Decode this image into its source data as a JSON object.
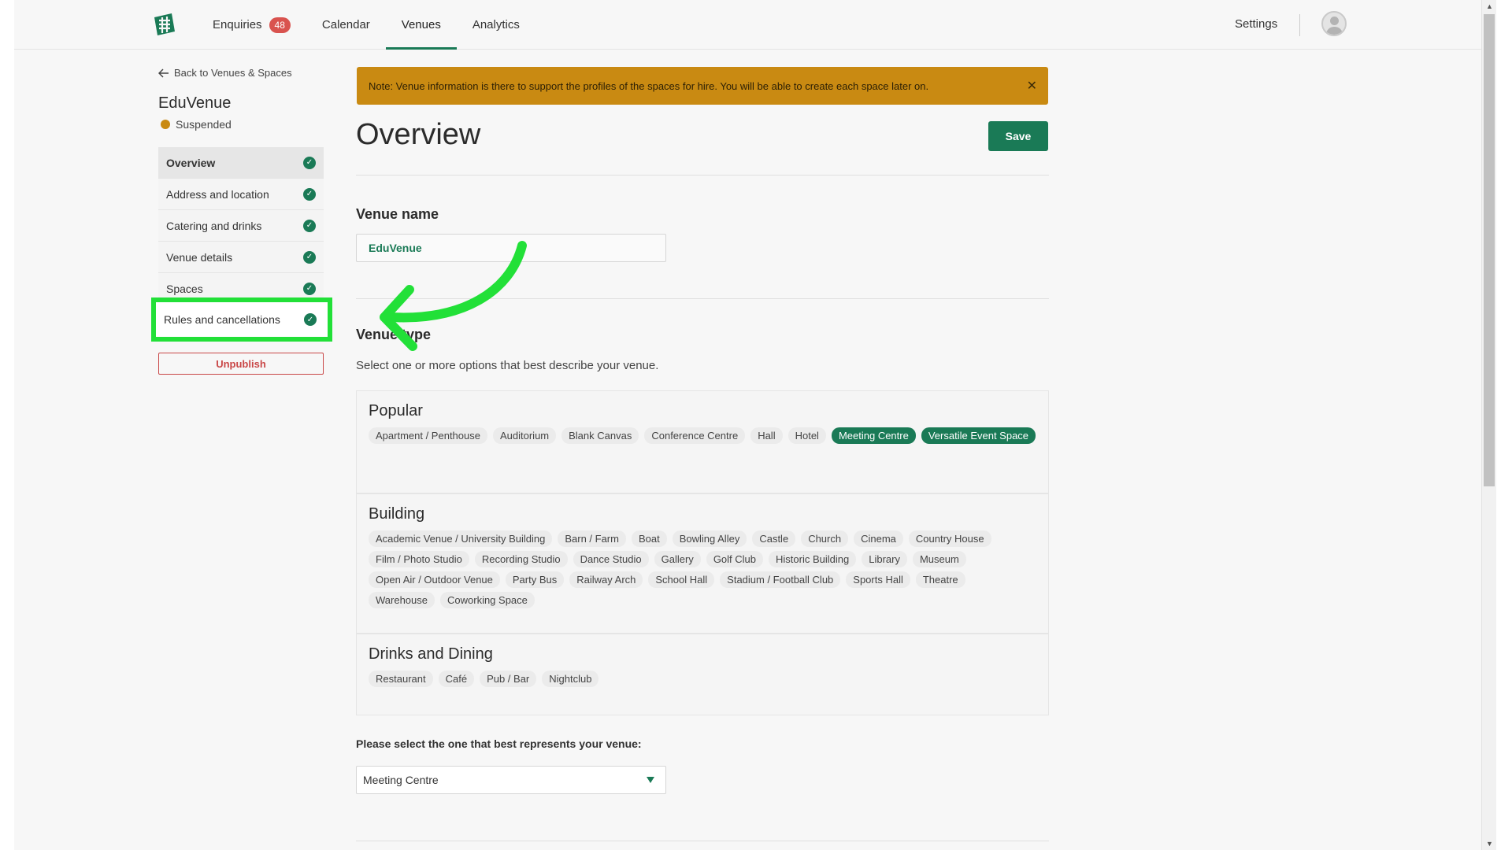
{
  "nav": {
    "items": [
      {
        "label": "Enquiries",
        "badge": "48"
      },
      {
        "label": "Calendar"
      },
      {
        "label": "Venues"
      },
      {
        "label": "Analytics"
      }
    ],
    "settings_label": "Settings"
  },
  "sidebar": {
    "back_label": "Back to Venues & Spaces",
    "venue_title": "EduVenue",
    "status": "Suspended",
    "items": [
      {
        "label": "Overview"
      },
      {
        "label": "Address and location"
      },
      {
        "label": "Catering and drinks"
      },
      {
        "label": "Venue details"
      },
      {
        "label": "Spaces"
      },
      {
        "label": "Rules and cancellations"
      }
    ],
    "unpublish_label": "Unpublish"
  },
  "main": {
    "note": "Note: Venue information is there to support the profiles of the spaces for hire. You will be able to create each space later on.",
    "title": "Overview",
    "save_label": "Save",
    "venue_name_label": "Venue name",
    "venue_name_value": "EduVenue",
    "venue_type_label": "Venue type",
    "venue_type_helper": "Select one or more options that best describe your venue.",
    "categories": [
      {
        "title": "Popular",
        "tags": [
          {
            "label": "Apartment / Penthouse"
          },
          {
            "label": "Auditorium"
          },
          {
            "label": "Blank Canvas"
          },
          {
            "label": "Conference Centre"
          },
          {
            "label": "Hall"
          },
          {
            "label": "Hotel"
          },
          {
            "label": "Meeting Centre",
            "selected": true
          },
          {
            "label": "Versatile Event Space",
            "selected": true
          }
        ]
      },
      {
        "title": "Building",
        "tags": [
          {
            "label": "Academic Venue / University Building"
          },
          {
            "label": "Barn / Farm"
          },
          {
            "label": "Boat"
          },
          {
            "label": "Bowling Alley"
          },
          {
            "label": "Castle"
          },
          {
            "label": "Church"
          },
          {
            "label": "Cinema"
          },
          {
            "label": "Country House"
          },
          {
            "label": "Film / Photo Studio"
          },
          {
            "label": "Recording Studio"
          },
          {
            "label": "Dance Studio"
          },
          {
            "label": "Gallery"
          },
          {
            "label": "Golf Club"
          },
          {
            "label": "Historic Building"
          },
          {
            "label": "Library"
          },
          {
            "label": "Museum"
          },
          {
            "label": "Open Air / Outdoor Venue"
          },
          {
            "label": "Party Bus"
          },
          {
            "label": "Railway Arch"
          },
          {
            "label": "School Hall"
          },
          {
            "label": "Stadium / Football Club"
          },
          {
            "label": "Sports Hall"
          },
          {
            "label": "Theatre"
          },
          {
            "label": "Warehouse"
          },
          {
            "label": "Coworking Space"
          }
        ]
      },
      {
        "title": "Drinks and Dining",
        "tags": [
          {
            "label": "Restaurant"
          },
          {
            "label": "Café"
          },
          {
            "label": "Pub / Bar"
          },
          {
            "label": "Nightclub"
          }
        ]
      }
    ],
    "represent_label": "Please select the one that best represents your venue:",
    "represent_value": "Meeting Centre"
  },
  "colors": {
    "accent": "#1a7a56",
    "warning": "#c98a12",
    "danger": "#c94747",
    "highlight": "#22e038"
  }
}
